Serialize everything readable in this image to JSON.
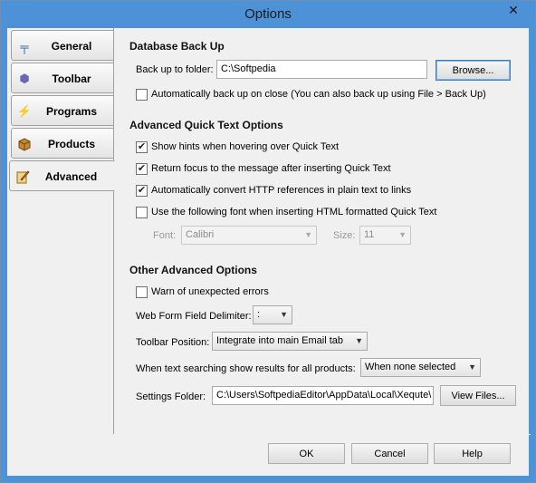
{
  "window": {
    "title": "Options",
    "close_glyph": "✕"
  },
  "sidebar": {
    "tabs": [
      {
        "label": "General",
        "icon": "general-settings-icon",
        "glyph": "╤"
      },
      {
        "label": "Toolbar",
        "icon": "toolbar-icon",
        "glyph": "⬢"
      },
      {
        "label": "Programs",
        "icon": "lightning-icon",
        "glyph": "⚡"
      },
      {
        "label": "Products",
        "icon": "box-icon",
        "glyph": "📦"
      },
      {
        "label": "Advanced",
        "icon": "pencil-notebook-icon",
        "glyph": "✎"
      }
    ],
    "active": "Advanced"
  },
  "backup": {
    "title": "Database Back Up",
    "folder_label": "Back up to folder:",
    "folder_value": "C:\\Softpedia",
    "browse_label": "Browse...",
    "auto_backup_label": "Automatically back up on close (You can also back up using File > Back Up)",
    "auto_backup_checked": false
  },
  "quicktext": {
    "title": "Advanced Quick Text Options",
    "show_hints_label": "Show hints when hovering over Quick Text",
    "show_hints_checked": true,
    "return_focus_label": "Return focus to the message after inserting Quick Text",
    "return_focus_checked": true,
    "auto_convert_label": "Automatically convert HTTP references in plain text to links",
    "auto_convert_checked": true,
    "use_font_label": "Use the following font when inserting HTML formatted Quick Text",
    "use_font_checked": false,
    "font_label": "Font:",
    "font_value": "Calibri",
    "size_label": "Size:",
    "size_value": "11"
  },
  "other": {
    "title": "Other Advanced Options",
    "warn_label": "Warn of unexpected errors",
    "warn_checked": false,
    "delimiter_label": "Web Form Field Delimiter:",
    "delimiter_value": ":",
    "toolbar_position_label": "Toolbar Position:",
    "toolbar_position_value": "Integrate into main Email tab",
    "search_label": "When text searching show results for all products:",
    "search_value": "When none selected",
    "settings_folder_label": "Settings Folder:",
    "settings_folder_value": "C:\\Users\\SoftpediaEditor\\AppData\\Local\\Xequte\\",
    "view_files_label": "View Files..."
  },
  "footer": {
    "ok_label": "OK",
    "cancel_label": "Cancel",
    "help_label": "Help"
  },
  "colors": {
    "titlebar": "#4d92d6",
    "background": "#f0f0f0"
  }
}
